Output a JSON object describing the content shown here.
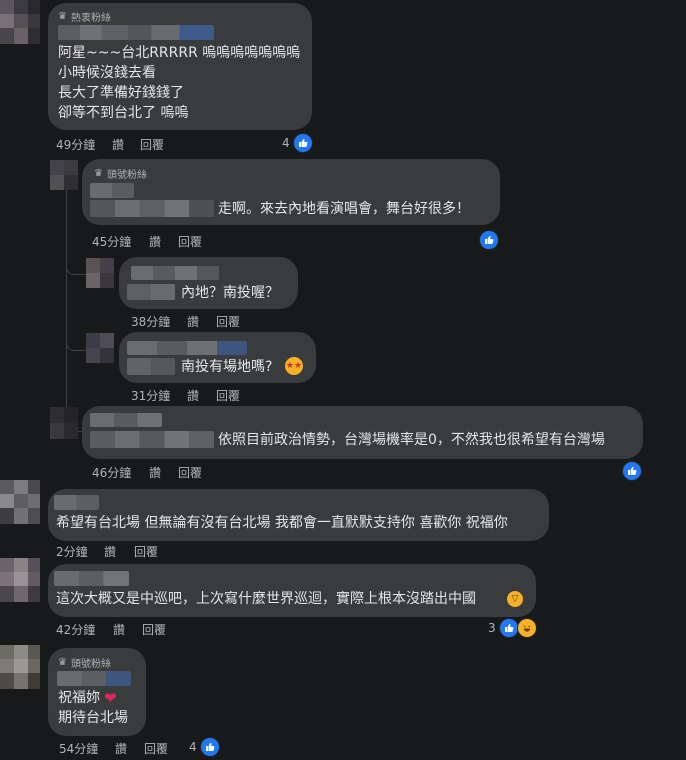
{
  "colors": {
    "bg": "#18191a",
    "bubble": "#3a3b3c",
    "text": "#e4e6eb",
    "meta": "#b0b3b8",
    "like": "#2078f4"
  },
  "comments": [
    {
      "badge": "熱衷粉絲",
      "lines": [
        "阿星~~~台北RRRRR 嗚嗚嗚嗚嗚嗚嗚",
        "小時候沒錢去看",
        "長大了準備好錢錢了",
        "卻等不到台北了 嗚嗚"
      ],
      "time": "49分鐘",
      "like": "讚",
      "reply": "回覆",
      "count": "4",
      "reactions": [
        "like-icon"
      ]
    },
    {
      "badge": "頭號粉絲",
      "lines": [
        "走啊。來去內地看演唱會，舞台好很多！"
      ],
      "time": "45分鐘",
      "like": "讚",
      "reply": "回覆",
      "reactions": [
        "like-icon"
      ]
    },
    {
      "lines": [
        "內地？南投喔？"
      ],
      "time": "38分鐘",
      "like": "讚",
      "reply": "回覆"
    },
    {
      "lines": [
        "南投有場地嗎?"
      ],
      "emoji": "star-struck-emoji",
      "time": "31分鐘",
      "like": "讚",
      "reply": "回覆"
    },
    {
      "lines": [
        "依照目前政治情勢，台灣場機率是0，不然我也很希望有台灣場"
      ],
      "time": "46分鐘",
      "like": "讚",
      "reply": "回覆",
      "reactions": [
        "like-icon"
      ]
    },
    {
      "lines": [
        "希望有台北場 但無論有沒有台北場 我都會一直默默支持你 喜歡你 祝福你"
      ],
      "time": "2分鐘",
      "like": "讚",
      "reply": "回覆"
    },
    {
      "lines": [
        "這次大概又是中巡吧，上次寫什麼世界巡迴，實際上根本沒踏出中國"
      ],
      "emoji": "laughing-emoji",
      "time": "42分鐘",
      "like": "讚",
      "reply": "回覆",
      "count": "3",
      "reactions": [
        "like-icon",
        "haha-icon"
      ]
    },
    {
      "badge": "頭號粉絲",
      "lines": [
        "祝福妳",
        "期待台北場"
      ],
      "emoji": "red-heart-emoji",
      "time": "54分鐘",
      "like": "讚",
      "reply": "回覆",
      "count": "4",
      "reactions": [
        "like-icon"
      ]
    }
  ]
}
